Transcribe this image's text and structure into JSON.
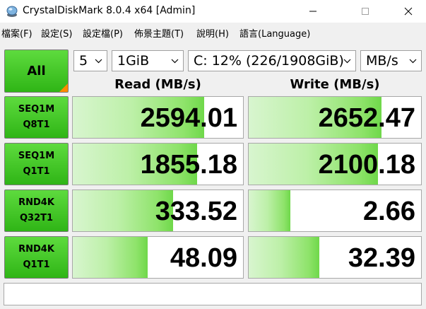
{
  "window": {
    "title": "CrystalDiskMark 8.0.4 x64 [Admin]"
  },
  "menu": {
    "items": [
      "檔案(F)",
      "設定(S)",
      "設定檔(P)",
      "佈景主題(T)",
      "說明(H)",
      "語言(Language)"
    ]
  },
  "controls": {
    "all_label": "All",
    "count": "5",
    "size": "1GiB",
    "drive": "C: 12% (226/1908GiB)",
    "unit": "MB/s"
  },
  "headers": {
    "read": "Read (MB/s)",
    "write": "Write (MB/s)"
  },
  "rows": [
    {
      "line1": "SEQ1M",
      "line2": "Q8T1",
      "read": "2594.01",
      "write": "2652.47",
      "read_fill": 0.77,
      "write_fill": 0.77
    },
    {
      "line1": "SEQ1M",
      "line2": "Q1T1",
      "read": "1855.18",
      "write": "2100.18",
      "read_fill": 0.73,
      "write_fill": 0.75
    },
    {
      "line1": "RND4K",
      "line2": "Q32T1",
      "read": "333.52",
      "write": "2.66",
      "read_fill": 0.59,
      "write_fill": 0.24
    },
    {
      "line1": "RND4K",
      "line2": "Q1T1",
      "read": "48.09",
      "write": "32.39",
      "read_fill": 0.44,
      "write_fill": 0.41
    }
  ],
  "comment": "",
  "colors": {
    "accent_green": "#4cc92c",
    "corner_orange": "#ff8a00"
  }
}
